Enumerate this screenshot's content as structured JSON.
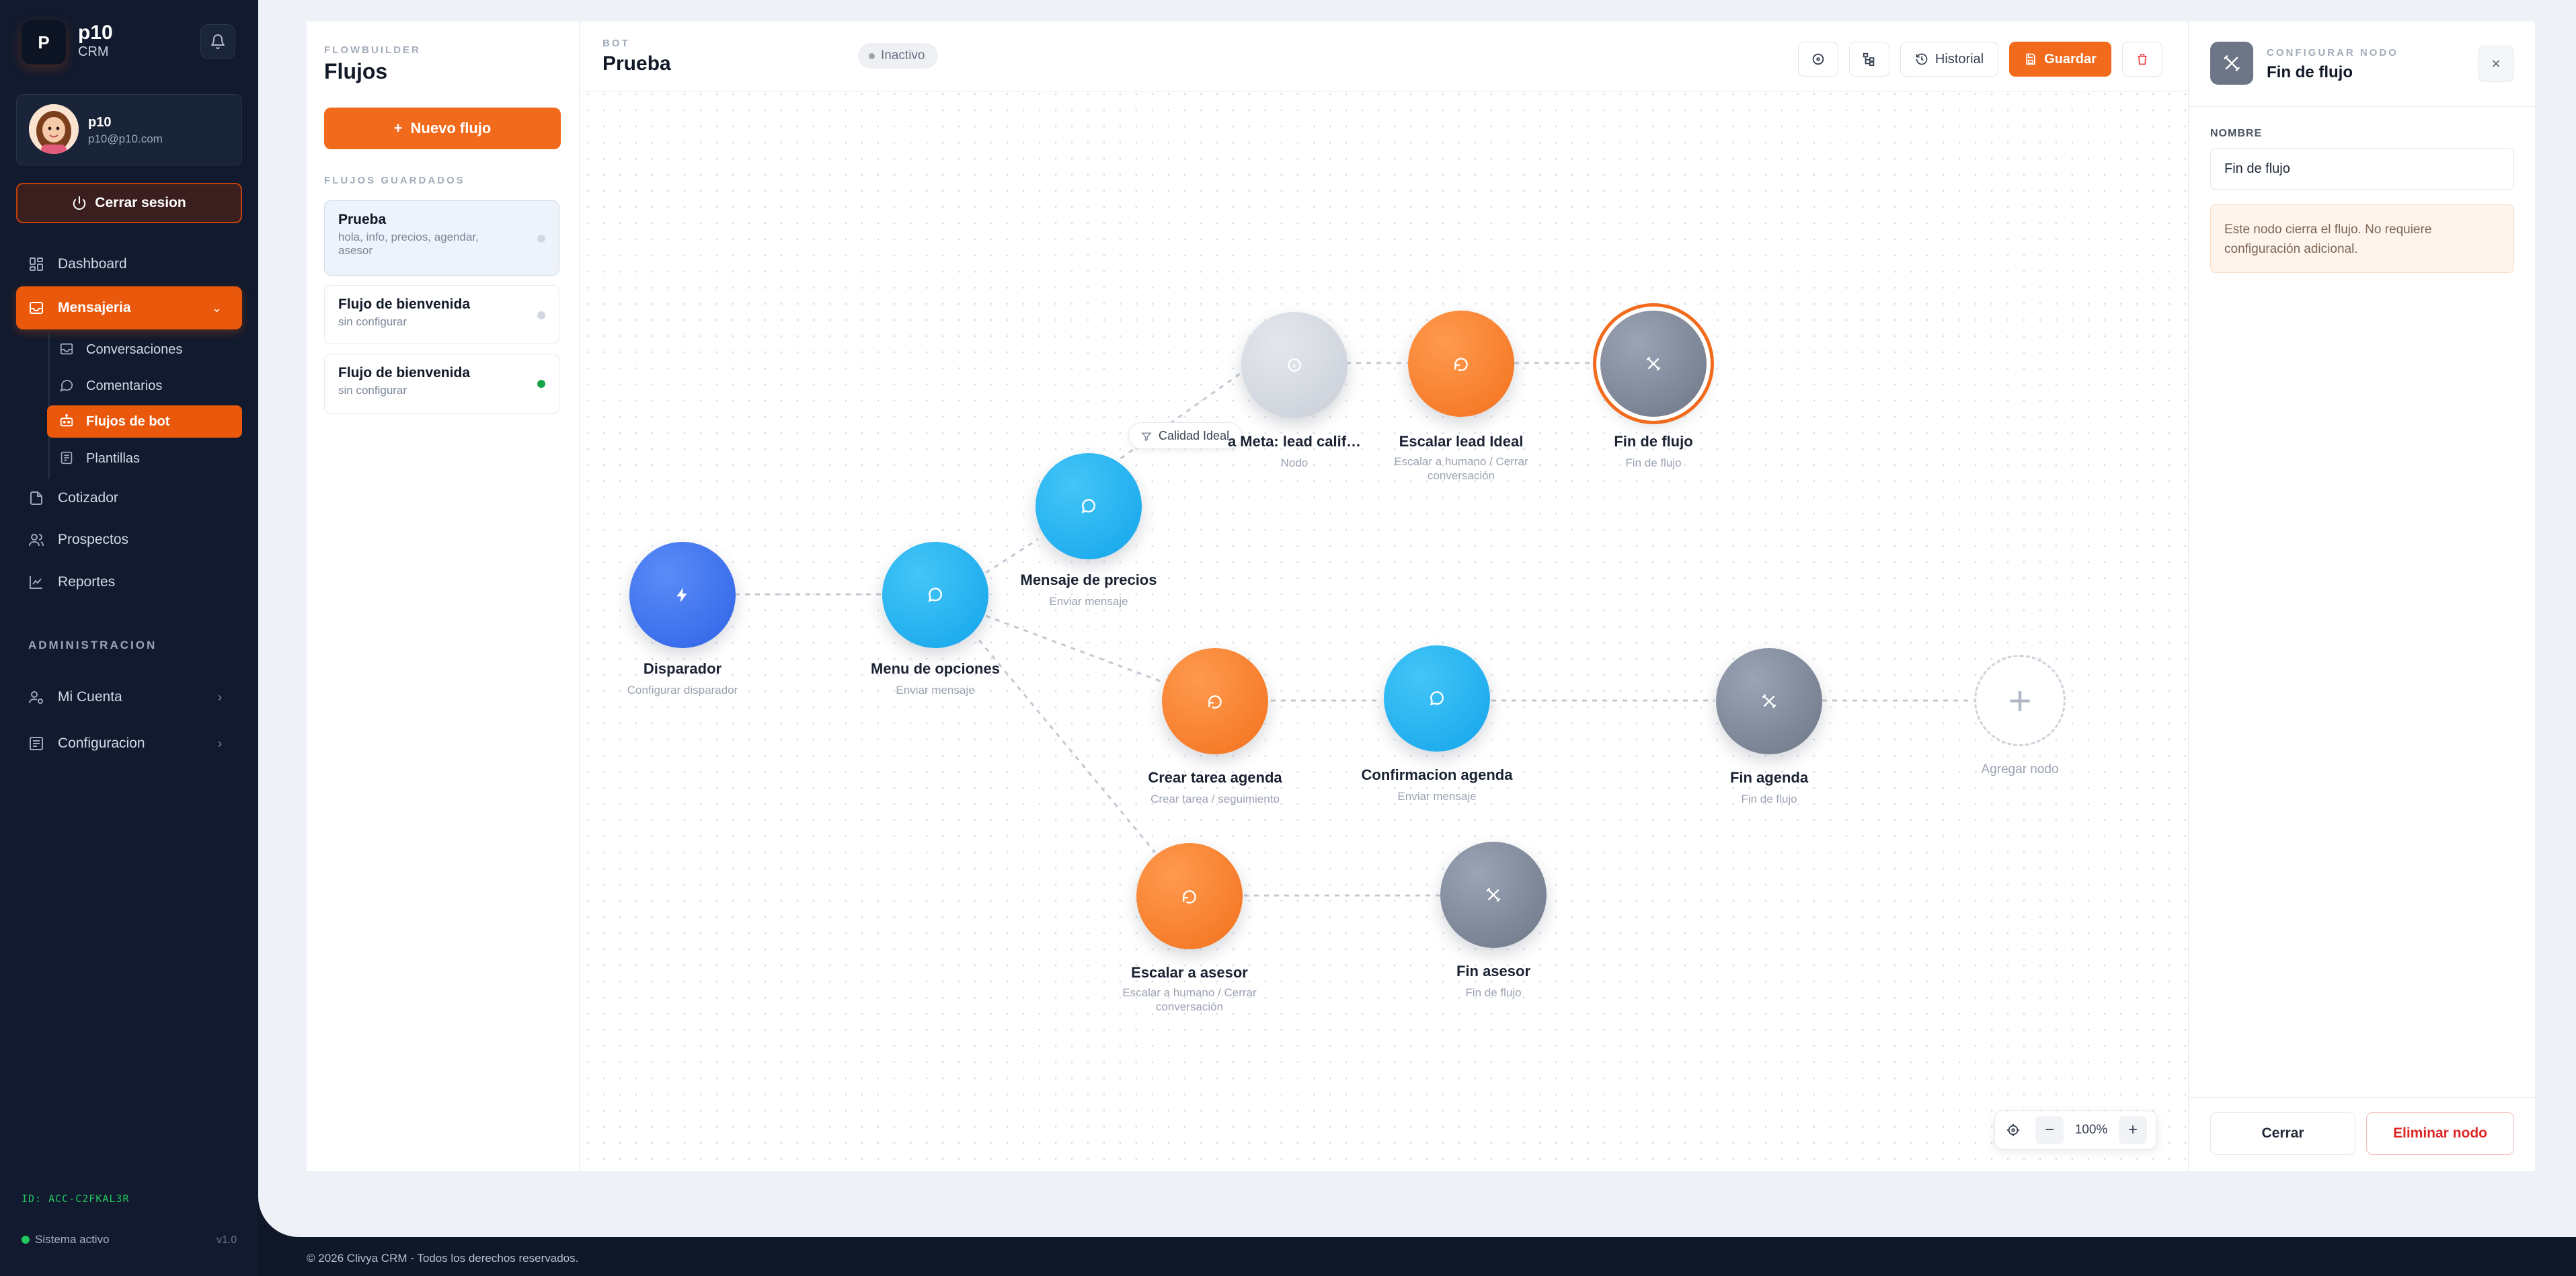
{
  "sidebar": {
    "brand_letter": "P",
    "brand_name": "p10",
    "brand_sub": "CRM",
    "user_name": "p10",
    "user_email": "p10@p10.com",
    "logout_label": "Cerrar sesion",
    "nav": {
      "dashboard": "Dashboard",
      "messaging": "Mensajeria",
      "conversations": "Conversaciones",
      "comments": "Comentarios",
      "bot_flows": "Flujos de bot",
      "templates": "Plantillas",
      "quoter": "Cotizador",
      "prospects": "Prospectos",
      "reports": "Reportes"
    },
    "admin_section": "ADMINISTRACION",
    "admin": {
      "account": "Mi Cuenta",
      "settings": "Configuracion"
    },
    "account_id": "ID: ACC-C2FKAL3R",
    "system_status": "Sistema activo",
    "version": "v1.0"
  },
  "flows_panel": {
    "eyebrow": "FLOWBUILDER",
    "title": "Flujos",
    "new_flow_label": "Nuevo flujo",
    "saved_heading": "FLUJOS GUARDADOS",
    "items": [
      {
        "name": "Prueba",
        "desc": "hola, info, precios, agendar, asesor",
        "status": "inactive"
      },
      {
        "name": "Flujo de bienvenida",
        "desc": "sin configurar",
        "status": "inactive"
      },
      {
        "name": "Flujo de bienvenida",
        "desc": "sin configurar",
        "status": "active"
      }
    ]
  },
  "canvas": {
    "eyebrow": "BOT",
    "bot_name": "Prueba",
    "status": "Inactivo",
    "history_label": "Historial",
    "save_label": "Guardar",
    "edge_tag": "Calidad Ideal",
    "zoom": "100%",
    "nodes": {
      "trigger": {
        "label": "Disparador",
        "sub": "Configurar disparador"
      },
      "menu": {
        "label": "Menu de opciones",
        "sub": "Enviar mensaje"
      },
      "prices": {
        "label": "Mensaje de precios",
        "sub": "Enviar mensaje"
      },
      "goal": {
        "label": "a Meta: lead calif…",
        "sub": "Nodo"
      },
      "escalate_lead": {
        "label": "Escalar lead Ideal",
        "sub": "Escalar a humano / Cerrar conversación"
      },
      "end_flow": {
        "label": "Fin de flujo",
        "sub": "Fin de flujo"
      },
      "create_task": {
        "label": "Crear tarea agenda",
        "sub": "Crear tarea / seguimiento"
      },
      "confirm": {
        "label": "Confirmacion agenda",
        "sub": "Enviar mensaje"
      },
      "end_agenda": {
        "label": "Fin agenda",
        "sub": "Fin de flujo"
      },
      "add": {
        "label": "Agregar nodo"
      },
      "escalate_advisor": {
        "label": "Escalar a asesor",
        "sub": "Escalar a humano / Cerrar conversación"
      },
      "end_advisor": {
        "label": "Fin asesor",
        "sub": "Fin de flujo"
      }
    }
  },
  "config_panel": {
    "eyebrow": "CONFIGURAR NODO",
    "title": "Fin de flujo",
    "name_label": "NOMBRE",
    "name_value": "Fin de flujo",
    "note": "Este nodo cierra el flujo. No requiere configuración adicional.",
    "close_label": "Cerrar",
    "delete_label": "Eliminar nodo"
  },
  "footer": "© 2026 Clivya CRM - Todos los derechos reservados.",
  "colors": {
    "accent": "#f26a1b",
    "sidebar_bg": "#111a2e",
    "trigger_blue": "#2f62e6",
    "message_sky": "#14a4eb",
    "action_orange": "#f2711d",
    "end_gray": "#6c7687",
    "active_green": "#22c55e"
  }
}
